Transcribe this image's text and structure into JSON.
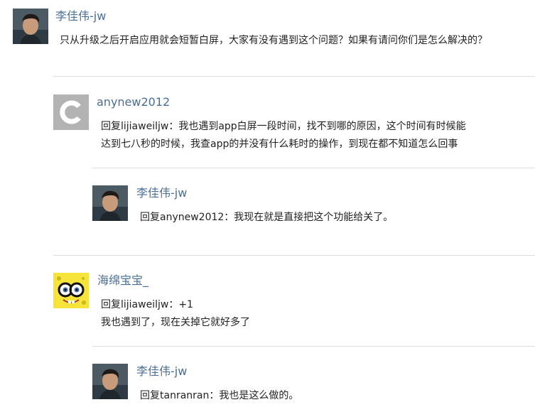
{
  "comments": [
    {
      "author": "李佳伟-jw",
      "avatar": "user-photo-avatar",
      "lines": [
        "只从升级之后开启应用就会短暂白屏，大家有没有遇到这个问题？如果有请问你们是怎么解决的？"
      ],
      "replies": [
        {
          "author": "anynew2012",
          "avatar": "letter-c-avatar",
          "lines": [
            "回复lijiaweiljw：我也遇到app白屏一段时间，找不到哪的原因，这个时间有时候能",
            "达到七八秒的时候，我查app的并没有什么耗时的操作，到现在都不知道怎么回事"
          ],
          "replies": [
            {
              "author": "李佳伟-jw",
              "avatar": "user-photo-avatar",
              "lines": [
                "回复anynew2012：我现在就是直接把这个功能给关了。"
              ]
            }
          ]
        },
        {
          "author": "海绵宝宝_",
          "avatar": "spongebob-avatar",
          "lines": [
            "回复lijiaweiljw：+1",
            "我也遇到了，现在关掉它就好多了"
          ],
          "replies": [
            {
              "author": "李佳伟-jw",
              "avatar": "user-photo-avatar",
              "lines": [
                "回复tanranran：我也是这么做的。"
              ]
            }
          ]
        }
      ]
    }
  ]
}
